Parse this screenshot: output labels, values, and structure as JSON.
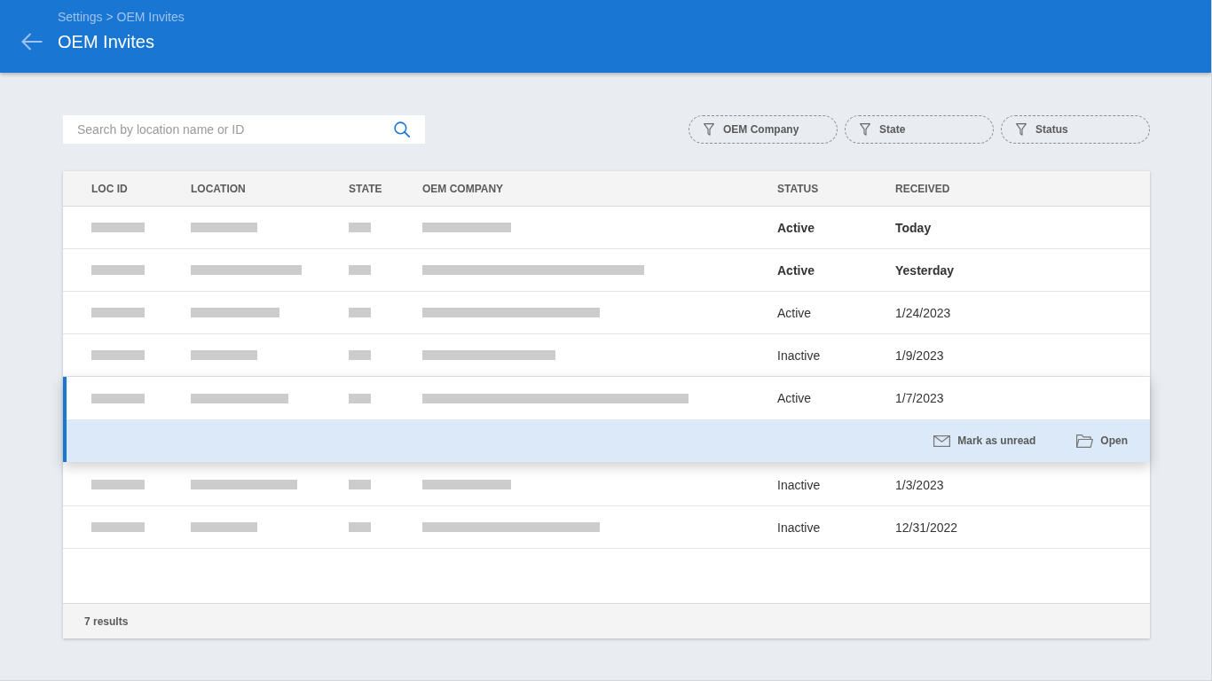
{
  "header": {
    "breadcrumb": "Settings > OEM Invites",
    "title": "OEM Invites"
  },
  "search": {
    "placeholder": "Search by location name or ID"
  },
  "filters": [
    {
      "label": "OEM Company"
    },
    {
      "label": "State"
    },
    {
      "label": "Status"
    }
  ],
  "table": {
    "columns": [
      {
        "label": "LOC ID",
        "kind": "masked"
      },
      {
        "label": "LOCATION",
        "kind": "masked"
      },
      {
        "label": "STATE",
        "kind": "masked"
      },
      {
        "label": "OEM COMPANY",
        "kind": "masked"
      },
      {
        "label": "STATUS",
        "kind": "status"
      },
      {
        "label": "RECEIVED",
        "kind": "received"
      }
    ],
    "rows": [
      {
        "status": "Active",
        "received": "Today",
        "unread": true,
        "selected": false
      },
      {
        "status": "Active",
        "received": "Yesterday",
        "unread": true,
        "selected": false
      },
      {
        "status": "Active",
        "received": "1/24/2023",
        "unread": false,
        "selected": false
      },
      {
        "status": "Inactive",
        "received": "1/9/2023",
        "unread": false,
        "selected": false
      },
      {
        "status": "Active",
        "received": "1/7/2023",
        "unread": false,
        "selected": true
      },
      {
        "status": "Inactive",
        "received": "1/3/2023",
        "unread": false,
        "selected": false
      },
      {
        "status": "Inactive",
        "received": "12/31/2022",
        "unread": false,
        "selected": false
      }
    ],
    "row_actions": [
      {
        "label": "Mark as unread",
        "kind": "mail"
      },
      {
        "label": "Open",
        "kind": "folder"
      }
    ],
    "footer": "7 results"
  }
}
